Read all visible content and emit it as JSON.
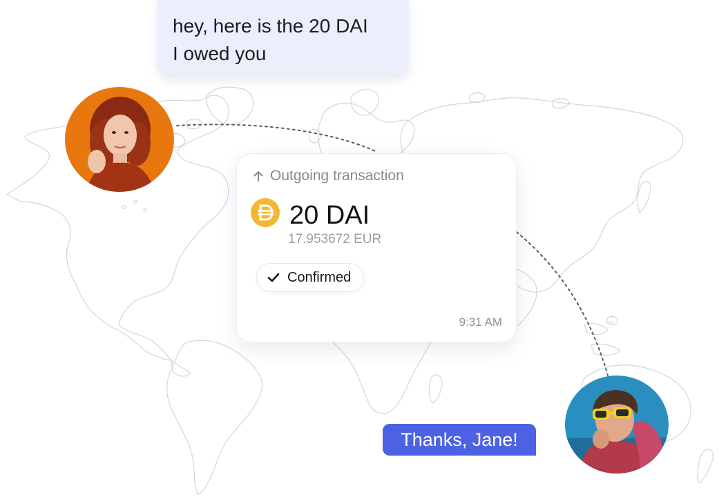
{
  "incoming_message": {
    "line1": "hey, here is the 20 DAI",
    "line2": "I owed you"
  },
  "sender": {
    "avatar_icon": "avatar-woman-red-hair",
    "bg_color": "#e8780e"
  },
  "recipient": {
    "avatar_icon": "avatar-man-yellow-sunglasses",
    "bg_color": "#2a8fc0"
  },
  "transaction": {
    "direction_icon": "arrow-up-icon",
    "header": "Outgoing transaction",
    "token_icon": "dai-icon",
    "token_color": "#f4b731",
    "amount": "20 DAI",
    "fiat_value": "17.953672 EUR",
    "status_icon": "checkmark-icon",
    "status": "Confirmed",
    "time": "9:31 AM"
  },
  "outgoing_message": {
    "text": "Thanks, Jane!",
    "bubble_color": "#4d62e3"
  },
  "colors": {
    "map_stroke": "#d2d4e0",
    "incoming_bubble": "#ebeefb"
  }
}
